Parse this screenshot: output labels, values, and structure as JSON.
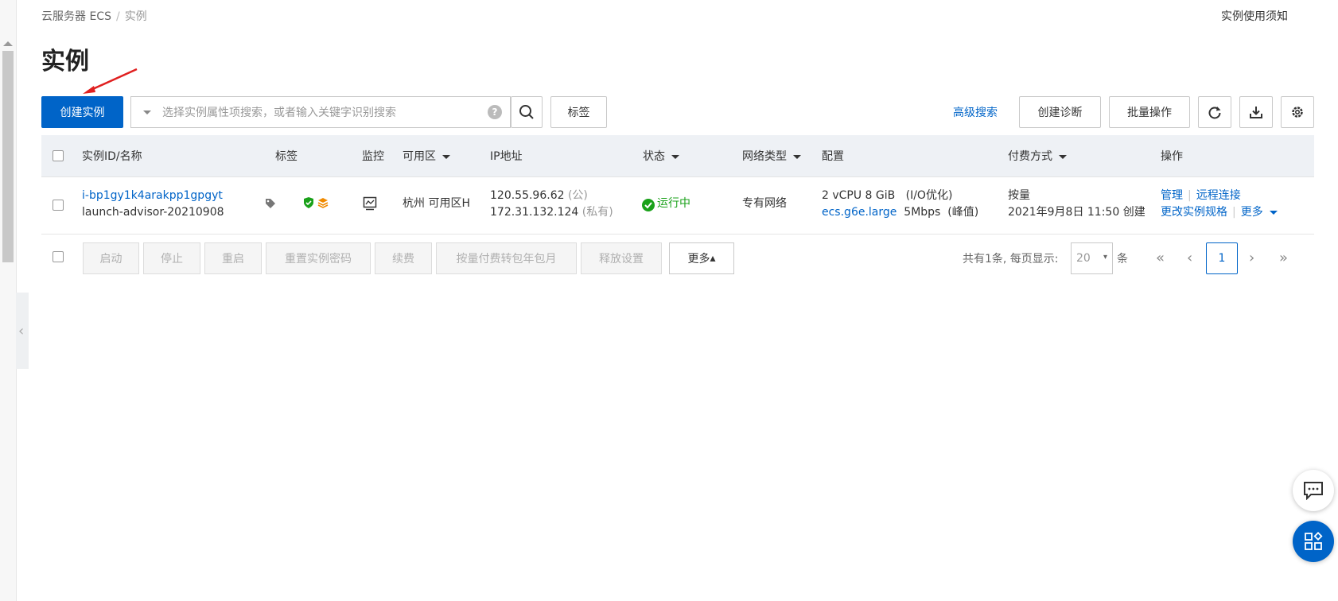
{
  "breadcrumb": {
    "root": "云服务器 ECS",
    "separator": "/",
    "current": "实例"
  },
  "notice_link": "实例使用须知",
  "page_title": "实例",
  "toolbar": {
    "create_label": "创建实例",
    "search_placeholder": "选择实例属性项搜索，或者输入关键字识别搜索",
    "help_glyph": "?",
    "tag_label": "标签",
    "advanced_search": "高级搜索",
    "diagnose_label": "创建诊断",
    "batch_label": "批量操作"
  },
  "table": {
    "headers": {
      "id": "实例ID/名称",
      "tags": "标签",
      "monitor": "监控",
      "zone": "可用区",
      "ip": "IP地址",
      "status": "状态",
      "network": "网络类型",
      "config": "配置",
      "billing": "付费方式",
      "actions": "操作"
    },
    "rows": [
      {
        "id": "i-bp1gy1k4arakpp1gpgyt",
        "name": "launch-advisor-20210908",
        "zone": "杭州 可用区H",
        "ip_public": "120.55.96.62",
        "ip_public_tag": "(公)",
        "ip_private": "172.31.132.124",
        "ip_private_tag": "(私有)",
        "status": "运行中",
        "network": "专有网络",
        "config_line1": "2 vCPU 8 GiB",
        "config_io": "(I/O优化)",
        "config_type": "ecs.g6e.large",
        "config_bw": "5Mbps",
        "config_peak": "(峰值)",
        "billing": "按量",
        "created": "2021年9月8日 11:50 创建",
        "action_manage": "管理",
        "action_remote": "远程连接",
        "action_change_spec": "更改实例规格",
        "action_more": "更多"
      }
    ]
  },
  "footer": {
    "buttons": [
      "启动",
      "停止",
      "重启",
      "重置实例密码",
      "续费",
      "按量付费转包年包月",
      "释放设置"
    ],
    "more_label": "更多",
    "more_glyph": "▴",
    "total_text": "共有1条, 每页显示:",
    "page_size": "20",
    "page_size_glyph": "▾",
    "unit": "条",
    "current_page": "1",
    "first_glyph": "«",
    "prev_glyph": "‹",
    "next_glyph": "›",
    "last_glyph": "»"
  },
  "colors": {
    "primary": "#0064c8",
    "running": "#1aa11a",
    "annotation_arrow": "#e02020"
  }
}
